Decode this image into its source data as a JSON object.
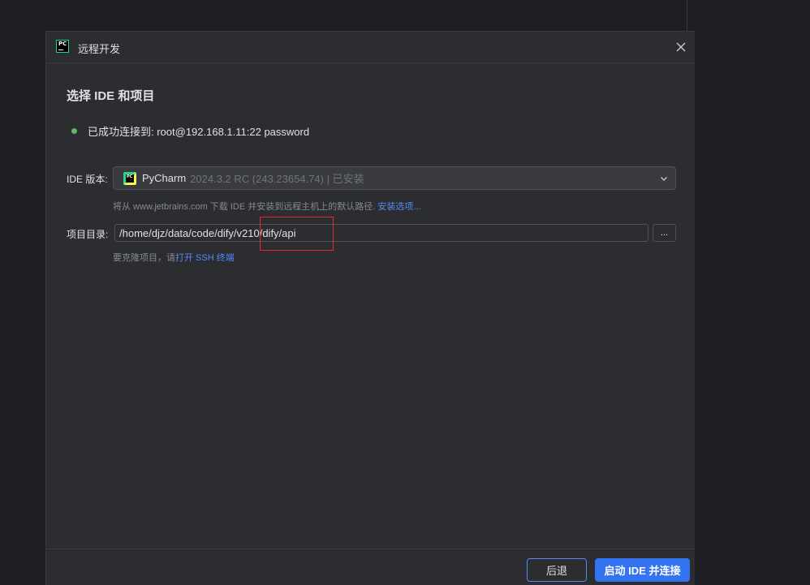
{
  "dialog": {
    "title": "远程开发",
    "heading": "选择 IDE 和项目"
  },
  "status": {
    "text": "已成功连接到: root@192.168.1.11:22 password",
    "color": "#5fb865"
  },
  "ide": {
    "label": "IDE 版本:",
    "name": "PyCharm",
    "version": "2024.3.2 RC (243.23654.74) | 已安装",
    "hint_prefix": "将从 www.jetbrains.com 下载 IDE 并安装到远程主机上的默认路径.",
    "hint_link": "安装选项..."
  },
  "project": {
    "label": "项目目录:",
    "value": "/home/djz/data/code/dify/v210/dify/api",
    "browse_label": "...",
    "hint_prefix": "要克隆项目，请",
    "hint_link": "打开 SSH 终端"
  },
  "footer": {
    "back_label": "后退",
    "primary_label": "启动 IDE 并连接"
  },
  "colors": {
    "accent": "#3574f0",
    "link": "#548af7",
    "highlight": "#e02c2c"
  }
}
